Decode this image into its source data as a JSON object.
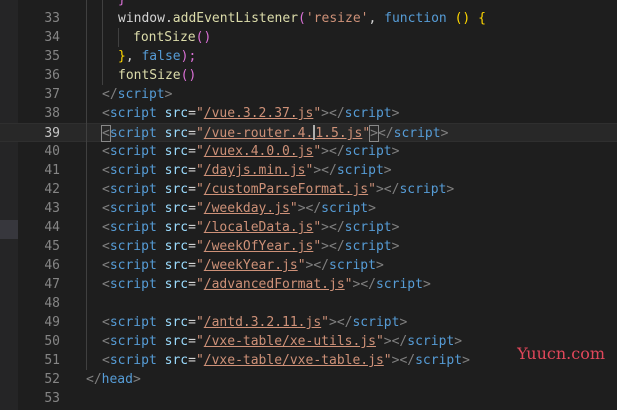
{
  "line_numbers": [
    "33",
    "34",
    "35",
    "36",
    "37",
    "38",
    "39",
    "40",
    "41",
    "42",
    "43",
    "44",
    "45",
    "46",
    "47",
    "48",
    "49",
    "50",
    "51",
    "52",
    "53"
  ],
  "active_line": "39",
  "code": {
    "l32_brace": "}",
    "l33_obj": "window",
    "l33_dot": ".",
    "l33_fn": "addEventListener",
    "l33_p": "(",
    "l33_str": "'resize'",
    "l33_comma": ", ",
    "l33_kw": "function",
    "l33_sp": " ",
    "l33_pp": "()",
    "l33_brace": " {",
    "l34_fn": "fontSize",
    "l34_pp": "()",
    "l35_brace": "}",
    "l35_comma": ", ",
    "l35_kw": "false",
    "l35_close": ");",
    "l36_fn": "fontSize",
    "l36_pp": "()",
    "open": "<",
    "close": ">",
    "close_open": "</",
    "script_tag": "script",
    "head_tag": "head",
    "src_attr": "src",
    "eq": "=",
    "quote": "\"",
    "srcs": [
      "/vue.3.2.37.js",
      "/vue-router.4.1.5.js",
      "/vuex.4.0.0.js",
      "/dayjs.min.js",
      "/customParseFormat.js",
      "/weekday.js",
      "/localeData.js",
      "/weekOfYear.js",
      "/weekYear.js",
      "/advancedFormat.js",
      "/antd.3.2.11.js",
      "/vxe-table/xe-utils.js",
      "/vxe-table/vxe-table.js"
    ],
    "l39_src_a": "/vue-router.4.",
    "l39_src_b": "1.5.js"
  },
  "watermark": "Yuucn.com"
}
